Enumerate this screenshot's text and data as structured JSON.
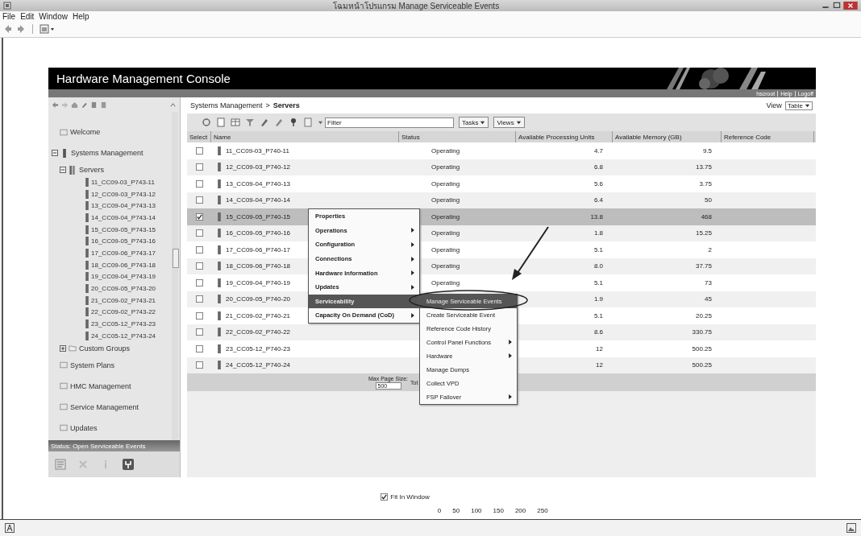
{
  "window": {
    "title": "โฉมหน้าโปรแกรม Manage Serviceable Events"
  },
  "menu_bar": [
    "File",
    "Edit",
    "Window",
    "Help"
  ],
  "banner": {
    "title": "Hardware Management Console",
    "links": [
      "hscroot",
      "Help",
      "Logoff"
    ]
  },
  "navigation": {
    "items": [
      {
        "label": "Welcome",
        "kind": "page"
      },
      {
        "label": "Systems Management",
        "kind": "group",
        "expanded": true,
        "children": [
          {
            "label": "Servers",
            "kind": "folder",
            "expanded": true,
            "children": [
              {
                "label": "11_CC09-03_P743-11"
              },
              {
                "label": "12_CC09-03_P743-12"
              },
              {
                "label": "13_CC09-04_P743-13"
              },
              {
                "label": "14_CC09-04_P743-14"
              },
              {
                "label": "15_CC09-05_P743-15"
              },
              {
                "label": "16_CC09-05_P743-16"
              },
              {
                "label": "17_CC09-06_P743-17"
              },
              {
                "label": "18_CC09-06_P743-18"
              },
              {
                "label": "19_CC09-04_P743-19"
              },
              {
                "label": "20_CC09-05_P743-20"
              },
              {
                "label": "21_CC09-02_P743-21"
              },
              {
                "label": "22_CC09-02_P743-22"
              },
              {
                "label": "23_CC05-12_P743-23"
              },
              {
                "label": "24_CC05-12_P743-24"
              }
            ]
          },
          {
            "label": "Custom Groups",
            "kind": "folder",
            "expanded": false
          }
        ]
      },
      {
        "label": "System Plans",
        "kind": "page"
      },
      {
        "label": "HMC Management",
        "kind": "page"
      },
      {
        "label": "Service Management",
        "kind": "page"
      },
      {
        "label": "Updates",
        "kind": "page"
      }
    ],
    "status": "Status: Open Serviceable Events"
  },
  "breadcrumb": {
    "items": [
      "Systems Management",
      "Servers"
    ],
    "separator": ">"
  },
  "view": {
    "label": "View",
    "value": "Table"
  },
  "filter": {
    "placeholder": "Filter"
  },
  "toolbar_menus": [
    "Tasks",
    "Views"
  ],
  "table": {
    "columns": [
      "Select",
      "Name",
      "Status",
      "Available Processing Units",
      "Available Memory (GB)",
      "Reference Code"
    ],
    "rows": [
      {
        "selected": false,
        "name": "11_CC09-03_P740-11",
        "status": "Operating",
        "units": "4.7",
        "memory": "9.5"
      },
      {
        "selected": false,
        "name": "12_CC09-03_P740-12",
        "status": "Operating",
        "units": "6.8",
        "memory": "13.75"
      },
      {
        "selected": false,
        "name": "13_CC09-04_P740-13",
        "status": "Operating",
        "units": "5.6",
        "memory": "3.75"
      },
      {
        "selected": false,
        "name": "14_CC09-04_P740-14",
        "status": "Operating",
        "units": "6.4",
        "memory": "50"
      },
      {
        "selected": true,
        "name": "15_CC09-05_P740-15",
        "status": "Operating",
        "units": "13.8",
        "memory": "468"
      },
      {
        "selected": false,
        "name": "16_CC09-05_P740-16",
        "status": "Operating",
        "units": "1.8",
        "memory": "15.25"
      },
      {
        "selected": false,
        "name": "17_CC09-06_P740-17",
        "status": "Operating",
        "units": "5.1",
        "memory": "2"
      },
      {
        "selected": false,
        "name": "18_CC09-06_P740-18",
        "status": "Operating",
        "units": "8.0",
        "memory": "37.75"
      },
      {
        "selected": false,
        "name": "19_CC09-04_P740-19",
        "status": "Operating",
        "units": "5.1",
        "memory": "73"
      },
      {
        "selected": false,
        "name": "20_CC09-05_P740-20",
        "units": "1.9",
        "memory": "45"
      },
      {
        "selected": false,
        "name": "21_CC09-02_P740-21",
        "units": "5.1",
        "memory": "20.25"
      },
      {
        "selected": false,
        "name": "22_CC09-02_P740-22",
        "units": "8.6",
        "memory": "330.75"
      },
      {
        "selected": false,
        "name": "23_CC05-12_P740-23",
        "units": "12",
        "memory": "500.25"
      },
      {
        "selected": false,
        "name": "24_CC05-12_P740-24",
        "units": "12",
        "memory": "500.25"
      }
    ],
    "footer": {
      "page_size_label": "Max Page Size:",
      "page_size": "500",
      "total_label": "Tot"
    }
  },
  "context_menu": {
    "items": [
      {
        "label": "Properties",
        "submenu": false,
        "selected": false
      },
      {
        "label": "Operations",
        "submenu": true,
        "selected": false
      },
      {
        "label": "Configuration",
        "submenu": true,
        "selected": false
      },
      {
        "label": "Connections",
        "submenu": true,
        "selected": false
      },
      {
        "label": "Hardware Information",
        "submenu": true,
        "selected": false
      },
      {
        "label": "Updates",
        "submenu": true,
        "selected": false
      },
      {
        "label": "Serviceability",
        "submenu": false,
        "selected": true
      },
      {
        "label": "Capacity On Demand (CoD)",
        "submenu": true,
        "selected": false
      }
    ]
  },
  "submenu": {
    "items": [
      {
        "label": "Manage Serviceable Events",
        "submenu": false,
        "selected": true
      },
      {
        "label": "Create Serviceable Event",
        "submenu": false,
        "selected": false
      },
      {
        "label": "Reference Code History",
        "submenu": false,
        "selected": false
      },
      {
        "label": "Control Panel Functions",
        "submenu": true,
        "selected": false
      },
      {
        "label": "Hardware",
        "submenu": true,
        "selected": false
      },
      {
        "label": "Manage Dumps",
        "submenu": false,
        "selected": false
      },
      {
        "label": "Collect VPD",
        "submenu": false,
        "selected": false
      },
      {
        "label": "FSP Failover",
        "submenu": true,
        "selected": false
      }
    ]
  },
  "zoom": {
    "fit_in_window": {
      "label": "Fit In Window",
      "checked": true
    },
    "scale": [
      "0",
      "50",
      "100",
      "150",
      "200",
      "250"
    ]
  }
}
